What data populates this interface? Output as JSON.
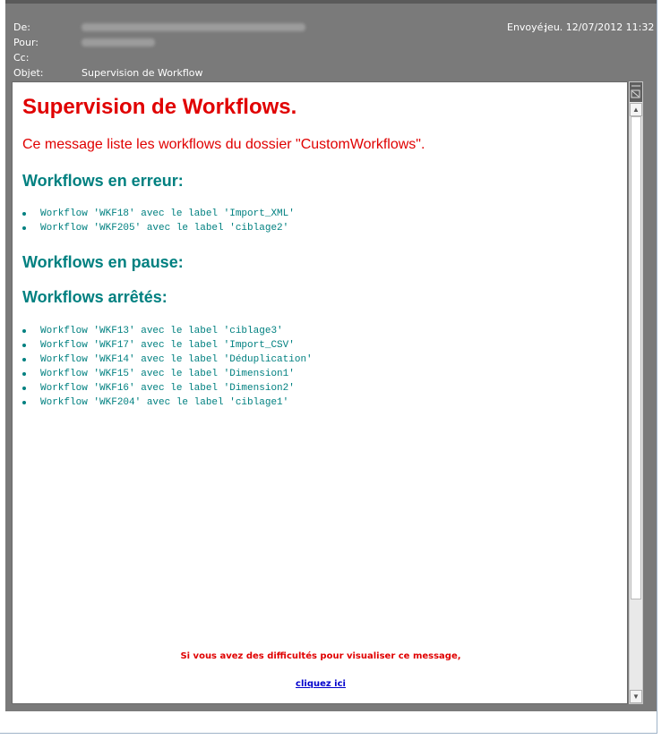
{
  "header": {
    "from_label": "De:",
    "to_label": "Pour:",
    "cc_label": "Cc:",
    "subject_label": "Objet:",
    "subject_value": "Supervision de Workflow",
    "sent_label": "Envoyé:",
    "sent_value": "jeu. 12/07/2012 11:32"
  },
  "message": {
    "title": "Supervision de Workflows.",
    "intro": "Ce message liste les workflows du dossier \"CustomWorkflows\".",
    "sections": {
      "error": {
        "heading": "Workflows en erreur:",
        "items": [
          "Workflow 'WKF18' avec le label 'Import_XML'",
          "Workflow 'WKF205' avec le label 'ciblage2'"
        ]
      },
      "paused": {
        "heading": "Workflows en pause:"
      },
      "stopped": {
        "heading": "Workflows arrêtés:",
        "items": [
          "Workflow 'WKF13' avec le label 'ciblage3'",
          "Workflow 'WKF17' avec le label 'Import_CSV'",
          "Workflow 'WKF14' avec le label 'Déduplication'",
          "Workflow 'WKF15' avec le label 'Dimension1'",
          "Workflow 'WKF16' avec le label 'Dimension2'",
          "Workflow 'WKF204' avec le label 'ciblage1'"
        ]
      }
    },
    "footer_text": "Si vous avez des difficultés pour visualiser ce message,",
    "footer_link": "cliquez ici"
  },
  "colors": {
    "title_red": "#e00000",
    "heading_teal": "#008080",
    "link_blue": "#0000cc",
    "header_gray": "#7a7a7a"
  },
  "icons": {
    "scroll_up": "arrow-up-icon",
    "scroll_down": "arrow-down-icon",
    "privacy": "picture-blocked-icon"
  }
}
